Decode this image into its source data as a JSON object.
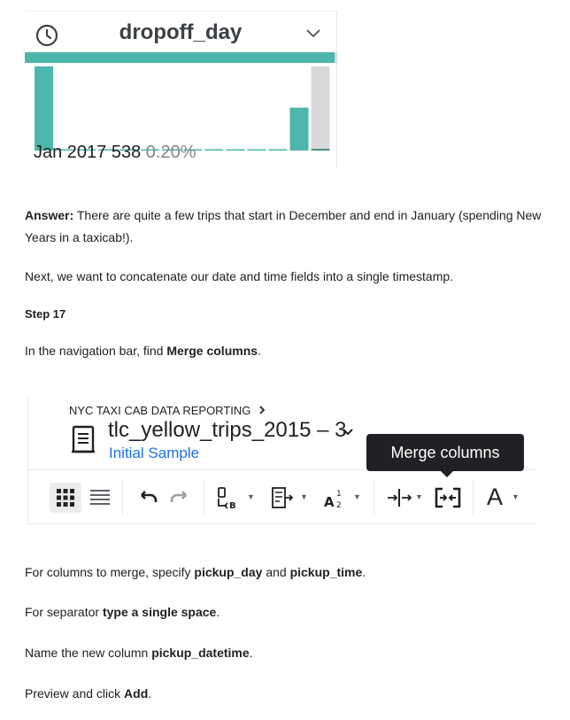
{
  "profile": {
    "column_name": "dropoff_day",
    "icons": {
      "type": "clock-icon",
      "menu": "chevron-down-icon"
    },
    "summary_label": "Jan 2017",
    "summary_count": "538",
    "summary_percent": "0.20%",
    "colors": {
      "teal": "#4db6ac",
      "grey": "#d9d9d9",
      "dark_teal": "#3d8c83"
    }
  },
  "chart_data": {
    "type": "bar",
    "categories": [
      "b1",
      "b2",
      "b3",
      "b4",
      "b5",
      "b6",
      "b7",
      "b8",
      "b9",
      "b10",
      "b11",
      "b12",
      "b13",
      "b14"
    ],
    "series": [
      {
        "values": [
          1.0,
          0.01,
          0.01,
          0.01,
          0.01,
          0.01,
          0.01,
          0.01,
          0.01,
          0.01,
          0.01,
          0.01,
          0.51,
          0.02
        ]
      },
      {
        "values": [
          0,
          0,
          0,
          0,
          0,
          0,
          0,
          0,
          0,
          0,
          0,
          0,
          0,
          1.0
        ]
      }
    ],
    "ylim": [
      0,
      1
    ]
  },
  "text": {
    "answer_label": "Answer:",
    "answer_text": " There are quite a few trips that start in December and end in January (spending New Years in a taxicab!).",
    "next_text": "Next, we want to concatenate our date and time fields into a single timestamp.",
    "step_label": "Step 17",
    "nav_pre": "In the navigation bar, find ",
    "nav_bold": "Merge columns",
    "nav_post": ".",
    "merge_pre": "For columns to merge, specify ",
    "merge_b1": "pickup_day",
    "merge_mid": " and ",
    "merge_b2": "pickup_time",
    "merge_post": ".",
    "sep_pre": "For separator ",
    "sep_bold": "type a single space",
    "sep_post": ".",
    "name_pre": "Name the new column ",
    "name_bold": "pickup_datetime",
    "name_post": ".",
    "prev_pre": "Preview and click ",
    "prev_bold": "Add",
    "prev_post": "."
  },
  "dataprep": {
    "breadcrumb": "NYC TAXI CAB DATA REPORTING",
    "breadcrumb_icon": "chevron-right-icon",
    "flow_name": "tlc_yellow_trips_2015 – 3",
    "sample_label": "Initial Sample",
    "tooltip": "Merge columns",
    "text_tool_label": "A",
    "toolbar_icons": [
      "grid-view-icon",
      "list-view-icon",
      "undo-icon",
      "redo-icon",
      "rename-icon",
      "filter-rows-icon",
      "format-icon",
      "split-column-icon",
      "merge-columns-icon",
      "text-format-icon"
    ]
  }
}
